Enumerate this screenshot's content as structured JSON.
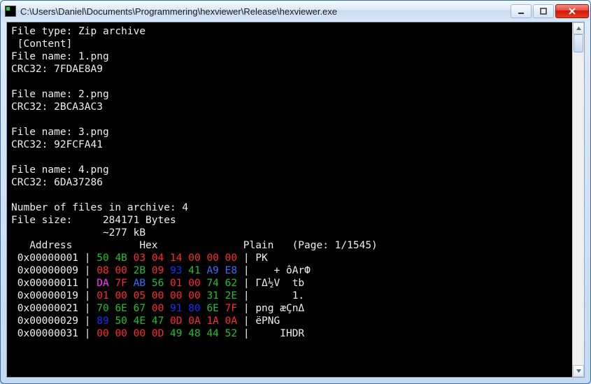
{
  "window": {
    "title": "C:\\Users\\Daniel\\Documents\\Programmering\\hexviewer\\Release\\hexviewer.exe"
  },
  "header_lines": [
    "File type: Zip archive",
    " [Content]",
    "File name: 1.png",
    "CRC32: 7FDAE8A9",
    "",
    "File name: 2.png",
    "CRC32: 2BCA3AC3",
    "",
    "File name: 3.png",
    "CRC32: 92FCFA41",
    "",
    "File name: 4.png",
    "CRC32: 6DA37286",
    "",
    "Number of files in archive: 4",
    "File size:     284171 Bytes",
    "               ~277 kB"
  ],
  "column_header": "   Address           Hex              Plain   (Page: 1/1545)",
  "page": {
    "current": 1,
    "total": 1545
  },
  "rows": [
    {
      "addr": "0x00000001",
      "hex": [
        {
          "v": "50",
          "c": "g"
        },
        {
          "v": "4B",
          "c": "g"
        },
        {
          "v": "03",
          "c": "r"
        },
        {
          "v": "04",
          "c": "r"
        },
        {
          "v": "14",
          "c": "r"
        },
        {
          "v": "00",
          "c": "r"
        },
        {
          "v": "00",
          "c": "r"
        },
        {
          "v": "00",
          "c": "r"
        }
      ],
      "plain": "PK"
    },
    {
      "addr": "0x00000009",
      "hex": [
        {
          "v": "08",
          "c": "r"
        },
        {
          "v": "00",
          "c": "r"
        },
        {
          "v": "2B",
          "c": "g"
        },
        {
          "v": "09",
          "c": "r"
        },
        {
          "v": "93",
          "c": "b"
        },
        {
          "v": "41",
          "c": "g"
        },
        {
          "v": "A9",
          "c": "l"
        },
        {
          "v": "E8",
          "c": "l"
        }
      ],
      "plain": "   + ôArФ"
    },
    {
      "addr": "0x00000011",
      "hex": [
        {
          "v": "DA",
          "c": "p"
        },
        {
          "v": "7F",
          "c": "r"
        },
        {
          "v": "AB",
          "c": "l"
        },
        {
          "v": "56",
          "c": "g"
        },
        {
          "v": "01",
          "c": "r"
        },
        {
          "v": "00",
          "c": "r"
        },
        {
          "v": "74",
          "c": "g"
        },
        {
          "v": "62",
          "c": "g"
        }
      ],
      "plain": "ΓΔ½V  tb"
    },
    {
      "addr": "0x00000019",
      "hex": [
        {
          "v": "01",
          "c": "r"
        },
        {
          "v": "00",
          "c": "r"
        },
        {
          "v": "05",
          "c": "r"
        },
        {
          "v": "00",
          "c": "r"
        },
        {
          "v": "00",
          "c": "r"
        },
        {
          "v": "00",
          "c": "r"
        },
        {
          "v": "31",
          "c": "g"
        },
        {
          "v": "2E",
          "c": "g"
        }
      ],
      "plain": "      1."
    },
    {
      "addr": "0x00000021",
      "hex": [
        {
          "v": "70",
          "c": "g"
        },
        {
          "v": "6E",
          "c": "g"
        },
        {
          "v": "67",
          "c": "g"
        },
        {
          "v": "00",
          "c": "r"
        },
        {
          "v": "91",
          "c": "b"
        },
        {
          "v": "80",
          "c": "b"
        },
        {
          "v": "6E",
          "c": "g"
        },
        {
          "v": "7F",
          "c": "r"
        }
      ],
      "plain": "png æÇnΔ"
    },
    {
      "addr": "0x00000029",
      "hex": [
        {
          "v": "89",
          "c": "b"
        },
        {
          "v": "50",
          "c": "g"
        },
        {
          "v": "4E",
          "c": "g"
        },
        {
          "v": "47",
          "c": "g"
        },
        {
          "v": "0D",
          "c": "r"
        },
        {
          "v": "0A",
          "c": "r"
        },
        {
          "v": "1A",
          "c": "r"
        },
        {
          "v": "0A",
          "c": "r"
        }
      ],
      "plain": "ëPNG"
    },
    {
      "addr": "0x00000031",
      "hex": [
        {
          "v": "00",
          "c": "r"
        },
        {
          "v": "00",
          "c": "r"
        },
        {
          "v": "00",
          "c": "r"
        },
        {
          "v": "0D",
          "c": "r"
        },
        {
          "v": "49",
          "c": "g"
        },
        {
          "v": "48",
          "c": "g"
        },
        {
          "v": "44",
          "c": "g"
        },
        {
          "v": "52",
          "c": "g"
        }
      ],
      "plain": "    IHDR"
    }
  ],
  "color_map": {
    "g": "#22c02a",
    "r": "#ff2a2a",
    "l": "#3b6aff",
    "b": "#1030ff",
    "p": "#ff33ff",
    "w": "#eeeeee"
  }
}
